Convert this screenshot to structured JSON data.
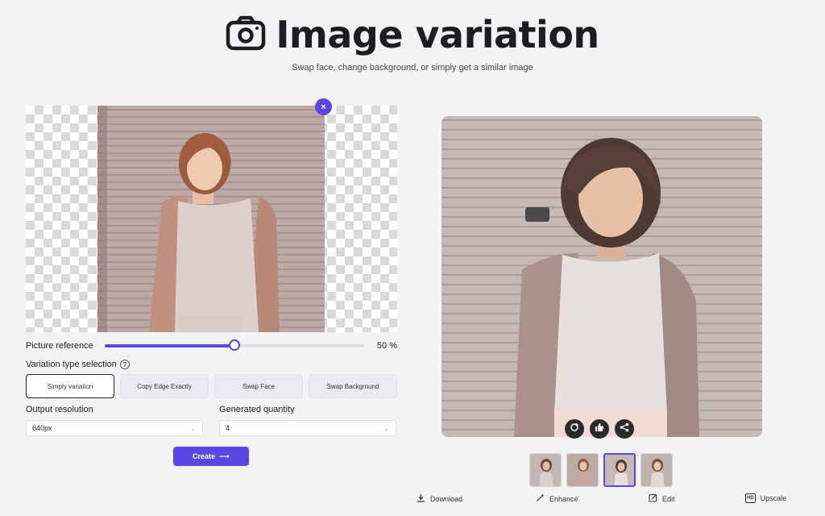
{
  "header": {
    "title": "Image variation",
    "subtitle": "Swap face, change background, or simply get a similar image"
  },
  "source": {
    "close_label": "×"
  },
  "picture_reference": {
    "label": "Picture reference",
    "value": 50,
    "value_text": "50 %"
  },
  "variation_type": {
    "label": "Variation type selection",
    "help_icon_text": "?",
    "options": [
      "Simply variation",
      "Copy Edge Exactly",
      "Swap Face",
      "Swap Background"
    ],
    "selected_index": 0
  },
  "output_resolution": {
    "label": "Output resolution",
    "value": "640px"
  },
  "generated_quantity": {
    "label": "Generated quantity",
    "value": "4"
  },
  "create_button": {
    "label": "Create",
    "arrow": "⟶"
  },
  "thumbnails": {
    "count": 4,
    "selected_index": 2
  },
  "bottom_actions": {
    "download": "Download",
    "enhance": "Enhance",
    "edit": "Edit",
    "upscale": "Upscale",
    "hd_badge": "HD"
  },
  "colors": {
    "accent": "#5a46e0",
    "background": "#f3f3f5"
  }
}
